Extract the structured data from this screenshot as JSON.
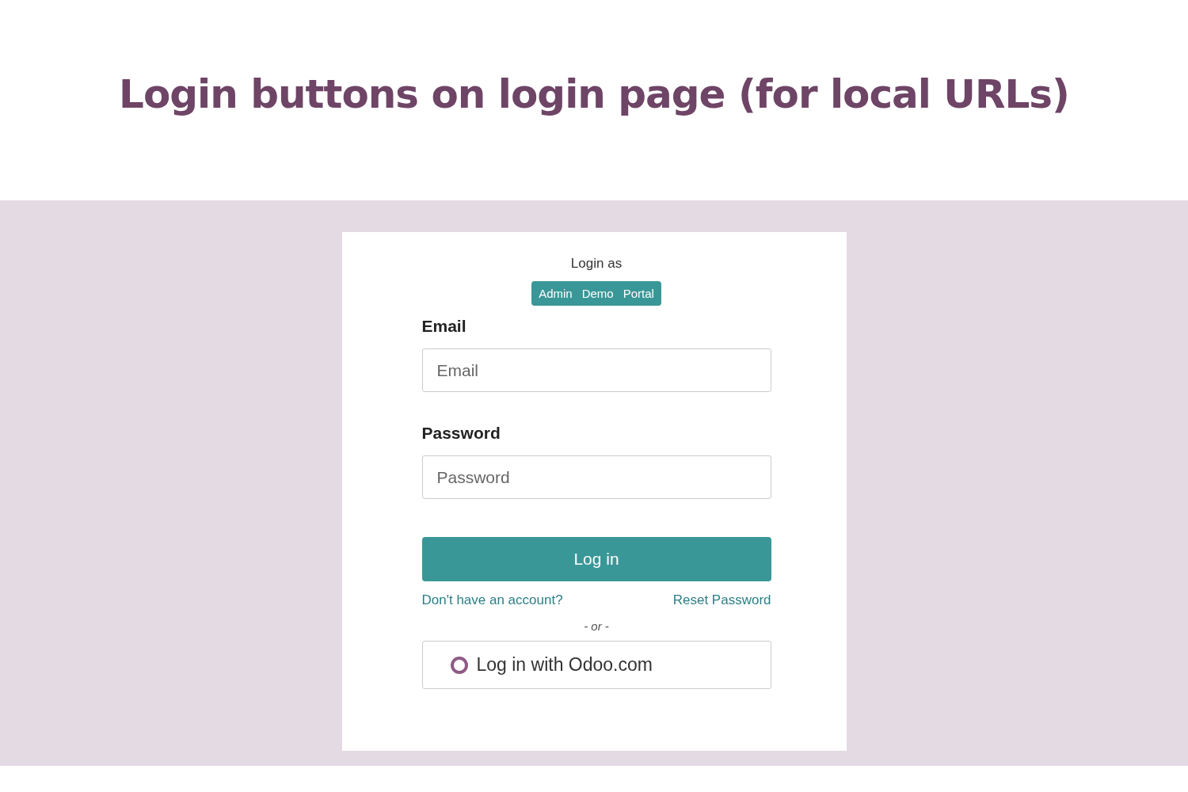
{
  "heading": "Login buttons on login page (for local URLs)",
  "login_as": {
    "label": "Login as",
    "buttons": [
      "Admin",
      "Demo",
      "Portal"
    ]
  },
  "fields": [
    {
      "label": "Email",
      "placeholder": "Email"
    },
    {
      "label": "Password",
      "placeholder": "Password"
    }
  ],
  "submit": "Log in",
  "links": [
    "Don't have an account?",
    "Reset Password"
  ],
  "separator": "- or -",
  "oauth_button": "Log in with Odoo.com"
}
